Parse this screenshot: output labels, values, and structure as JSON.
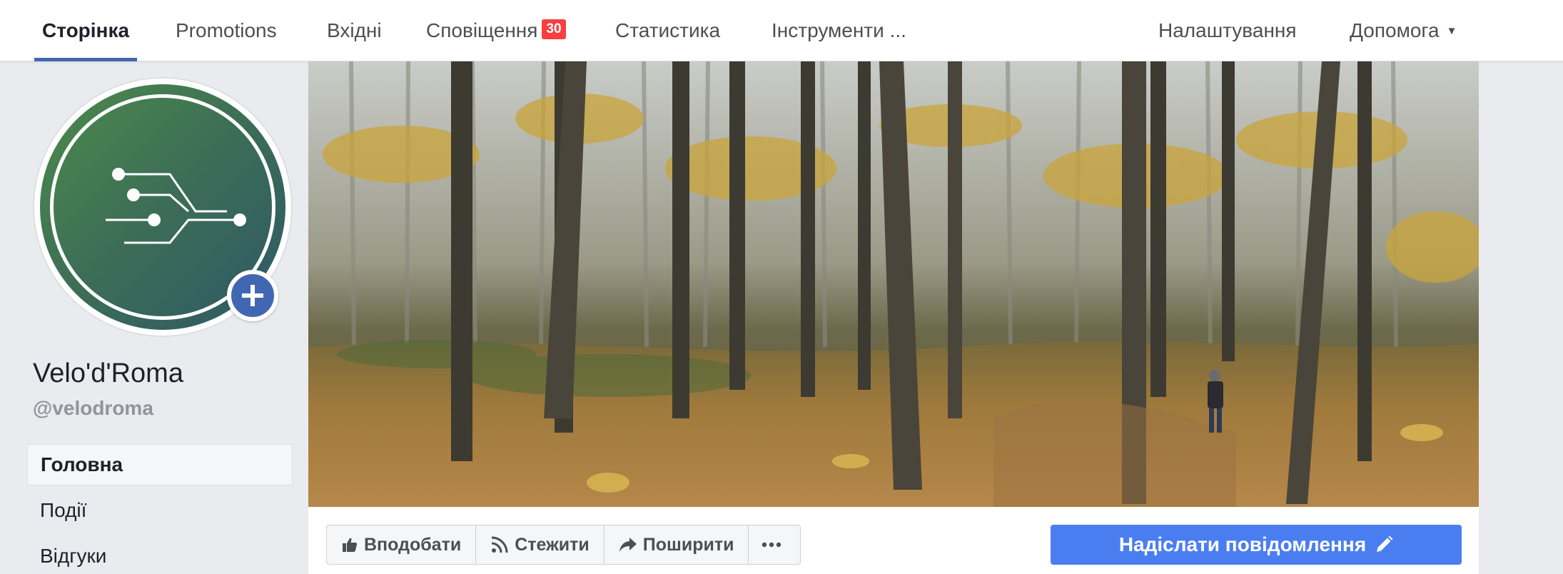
{
  "nav": {
    "tabs": [
      {
        "label": "Сторінка"
      },
      {
        "label": "Promotions"
      },
      {
        "label": "Вхідні"
      },
      {
        "label": "Сповіщення",
        "badge": "30"
      },
      {
        "label": "Статистика"
      },
      {
        "label": "Інструменти ..."
      }
    ],
    "right": [
      {
        "label": "Налаштування"
      },
      {
        "label": "Допомога"
      }
    ]
  },
  "profile": {
    "name": "Velo'd'Roma",
    "handle": "@velodroma"
  },
  "sidebar": {
    "items": [
      {
        "label": "Головна"
      },
      {
        "label": "Події"
      },
      {
        "label": "Відгуки"
      }
    ]
  },
  "actions": {
    "like": "Вподобати",
    "follow": "Стежити",
    "share": "Поширити",
    "send_message": "Надіслати повідомлення"
  },
  "colors": {
    "accent": "#4267b2",
    "message_button": "#4a7ef0",
    "badge": "#fa3e3e"
  }
}
